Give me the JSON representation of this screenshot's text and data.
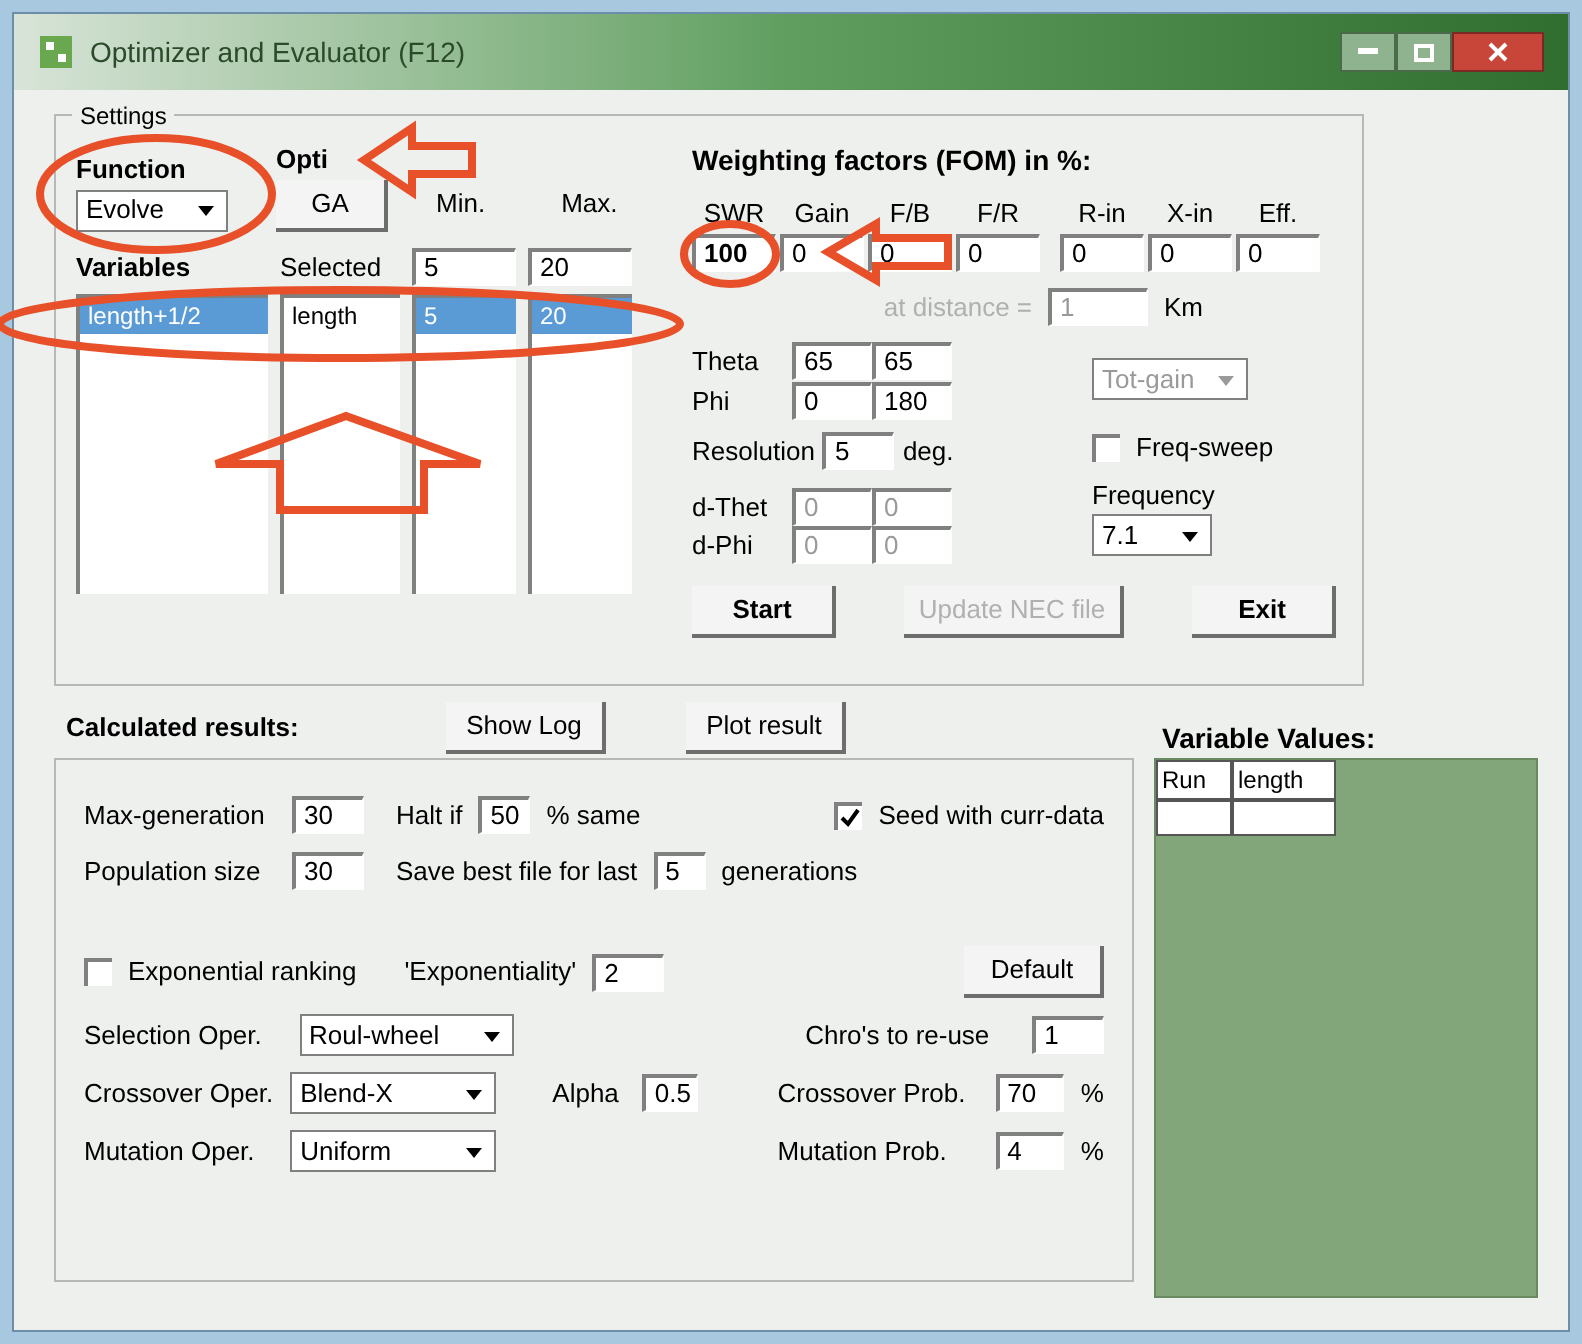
{
  "window": {
    "title": "Optimizer and Evaluator (F12)"
  },
  "settings": {
    "label": "Settings",
    "function": {
      "label": "Function",
      "value": "Evolve"
    },
    "options": {
      "label": "Opti",
      "button": "GA"
    },
    "min_label": "Min.",
    "max_label": "Max.",
    "variables": {
      "label": "Variables",
      "items": [
        {
          "text": "length+1/2",
          "selected": true
        }
      ]
    },
    "selected": {
      "label": "Selected",
      "items": [
        {
          "text": "length",
          "selected": false
        }
      ]
    },
    "min": {
      "value": "5",
      "items": [
        {
          "text": "5",
          "selected": true
        }
      ]
    },
    "max": {
      "value": "20",
      "items": [
        {
          "text": "20",
          "selected": true
        }
      ]
    },
    "weighting": {
      "title": "Weighting factors (FOM) in %:",
      "factors": [
        {
          "label": "SWR",
          "value": "100"
        },
        {
          "label": "Gain",
          "value": "0"
        },
        {
          "label": "F/B",
          "value": "0"
        },
        {
          "label": "F/R",
          "value": "0"
        },
        {
          "label": "R-in",
          "value": "0"
        },
        {
          "label": "X-in",
          "value": "0"
        },
        {
          "label": "Eff.",
          "value": "0"
        }
      ]
    },
    "distance": {
      "label": "at distance =",
      "value": "1",
      "unit": "Km",
      "disabled": true
    },
    "angles": [
      {
        "label": "Theta",
        "from": "65",
        "to": "65"
      },
      {
        "label": "Phi",
        "from": "0",
        "to": "180"
      }
    ],
    "gain_type": {
      "value": "Tot-gain",
      "disabled": true
    },
    "resolution": {
      "label": "Resolution",
      "value": "5",
      "unit": "deg."
    },
    "freq_sweep": {
      "label": "Freq-sweep",
      "checked": false
    },
    "deltas": [
      {
        "label": "d-Thet",
        "from": "0",
        "to": "0"
      },
      {
        "label": "d-Phi",
        "from": "0",
        "to": "0"
      }
    ],
    "frequency": {
      "label": "Frequency",
      "value": "7.1"
    },
    "buttons": [
      {
        "label": "Start",
        "disabled": false
      },
      {
        "label": "Update NEC file",
        "disabled": true
      },
      {
        "label": "Exit",
        "disabled": false
      }
    ]
  },
  "results": {
    "label": "Calculated results:",
    "buttons": [
      "Show Log",
      "Plot result"
    ],
    "max_generation": {
      "label": "Max-generation",
      "value": "30"
    },
    "halt": {
      "label": "Halt if",
      "value": "50",
      "unit": "% same"
    },
    "seed": {
      "label": "Seed with curr-data",
      "checked": true
    },
    "population": {
      "label": "Population size",
      "value": "30"
    },
    "save_best": {
      "label": "Save best file for last",
      "value": "5",
      "unit": "generations"
    },
    "exp_ranking": {
      "label": "Exponential ranking",
      "checked": false
    },
    "exponentiality": {
      "label": "'Exponentiality'",
      "value": "2"
    },
    "default_button": "Default",
    "selection": {
      "label": "Selection Oper.",
      "value": "Roul-wheel"
    },
    "crossover": {
      "label": "Crossover Oper.",
      "value": "Blend-X"
    },
    "mutation": {
      "label": "Mutation Oper.",
      "value": "Uniform"
    },
    "alpha": {
      "label": "Alpha",
      "value": "0.5"
    },
    "reuse": {
      "label": "Chro's to re-use",
      "value": "1"
    },
    "crossover_prob": {
      "label": "Crossover Prob.",
      "value": "70",
      "unit": "%"
    },
    "mutation_prob": {
      "label": "Mutation Prob.",
      "value": "4",
      "unit": "%"
    }
  },
  "variable_values": {
    "label": "Variable Values:",
    "columns": [
      "Run",
      "length"
    ]
  }
}
